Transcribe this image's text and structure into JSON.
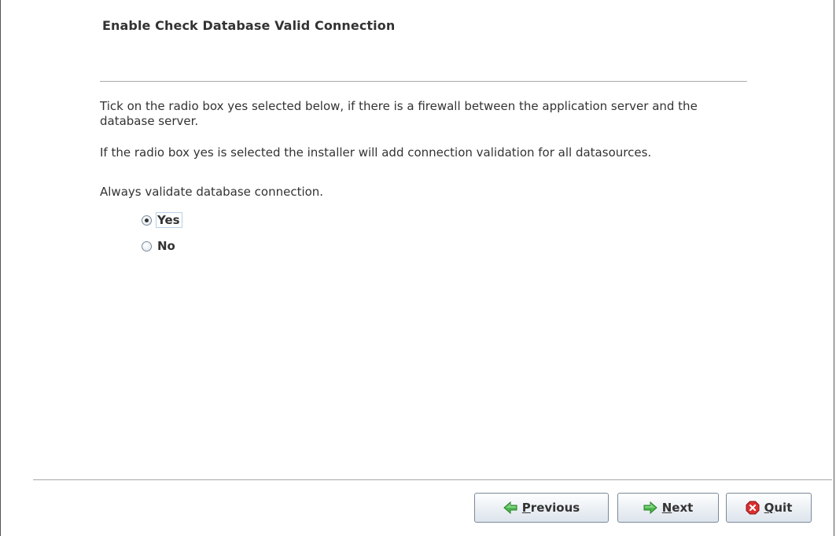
{
  "header": {
    "title": "Enable Check Database Valid Connection"
  },
  "body": {
    "paragraph1": "Tick on the radio box yes selected below, if there is a firewall between the application server and the database server.",
    "paragraph2": "If the radio box yes is selected the installer will add connection validation for all datasources.",
    "paragraph3": "Always validate database connection."
  },
  "options": {
    "selected": "Yes",
    "yes_label": "Yes",
    "no_label": "No"
  },
  "buttons": {
    "previous_mnemonic": "P",
    "previous_rest": "revious",
    "next_mnemonic": "N",
    "next_rest": "ext",
    "quit_mnemonic": "Q",
    "quit_rest": "uit"
  },
  "icons": {
    "previous": "arrow-left-icon",
    "next": "arrow-right-icon",
    "quit": "stop-icon"
  },
  "colors": {
    "arrow_green": "#3aa63a",
    "quit_red": "#d42a2a"
  }
}
